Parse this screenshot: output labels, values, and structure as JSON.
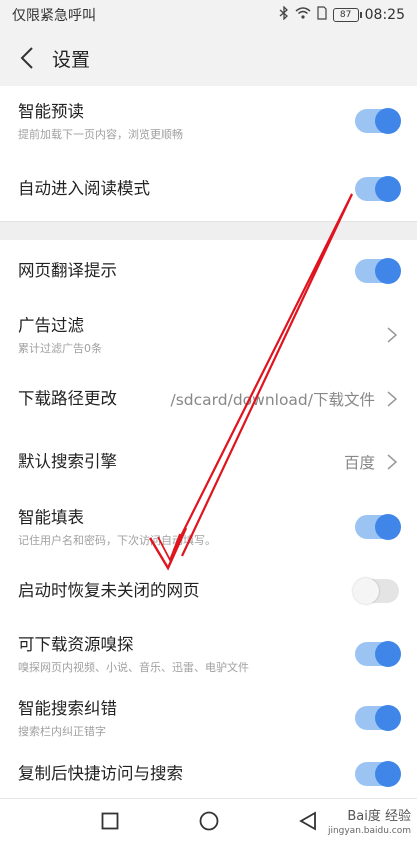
{
  "status_bar": {
    "carrier": "仅限紧急呼叫",
    "battery": "87",
    "time": "08:25"
  },
  "header": {
    "title": "设置"
  },
  "settings": [
    {
      "label": "智能预读",
      "sub": "提前加载下一页内容，浏览更顺畅",
      "toggle": "on"
    },
    {
      "label": "自动进入阅读模式",
      "toggle": "on"
    },
    {
      "label": "网页翻译提示",
      "toggle": "on"
    },
    {
      "label": "广告过滤",
      "sub": "累计过滤广告0条",
      "chevron": true
    },
    {
      "label": "下载路径更改",
      "value": "/sdcard/download/下载文件",
      "chevron": true
    },
    {
      "label": "默认搜索引擎",
      "value": "百度",
      "chevron": true
    },
    {
      "label": "智能填表",
      "sub": "记住用户名和密码，下次访问自动填写。",
      "toggle": "on"
    },
    {
      "label": "启动时恢复未关闭的网页",
      "toggle": "off"
    },
    {
      "label": "可下载资源嗅探",
      "sub": "嗅探网页内视频、小说、音乐、迅雷、电驴文件",
      "toggle": "on"
    },
    {
      "label": "智能搜索纠错",
      "sub": "搜索栏内纠正错字",
      "toggle": "on"
    },
    {
      "label": "复制后快捷访问与搜索",
      "toggle": "on"
    }
  ],
  "watermark": {
    "brand": "Bai度 经验",
    "url": "jingyan.baidu.com"
  },
  "colors": {
    "toggle_on_track": "#9cc4f2",
    "toggle_on_knob": "#3f86e8",
    "annotation_arrow": "#e0141e"
  }
}
